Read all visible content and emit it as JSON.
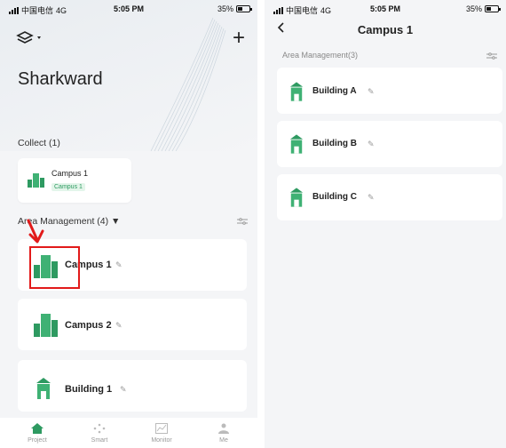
{
  "status_bar": {
    "carrier": "中国电信",
    "network": "4G",
    "time": "5:05 PM",
    "battery": "35%"
  },
  "left_screen": {
    "app_title": "Sharkward",
    "collect": {
      "label": "Collect (1)",
      "items": [
        {
          "name": "Campus 1",
          "tag": "Campus 1"
        }
      ]
    },
    "area_management": {
      "label": "Area Management (4) ▼",
      "items": [
        {
          "name": "Campus 1",
          "icon": "campus-icon"
        },
        {
          "name": "Campus 2",
          "icon": "campus-icon"
        },
        {
          "name": "Building 1",
          "icon": "building-icon"
        }
      ]
    },
    "tabs": [
      {
        "label": "Project",
        "icon": "home-icon",
        "active": true
      },
      {
        "label": "Smart",
        "icon": "dots-icon",
        "active": false
      },
      {
        "label": "Monitor",
        "icon": "chart-icon",
        "active": false
      },
      {
        "label": "Me",
        "icon": "person-icon",
        "active": false
      }
    ]
  },
  "right_screen": {
    "title": "Campus 1",
    "section_label": "Area Management(3)",
    "items": [
      {
        "name": "Building A",
        "icon": "building-icon"
      },
      {
        "name": "Building B",
        "icon": "building-icon"
      },
      {
        "name": "Building C",
        "icon": "building-icon"
      }
    ]
  },
  "colors": {
    "accent_green": "#2e9a61",
    "highlight_red": "#e21a1a",
    "background": "#f4f5f7"
  }
}
